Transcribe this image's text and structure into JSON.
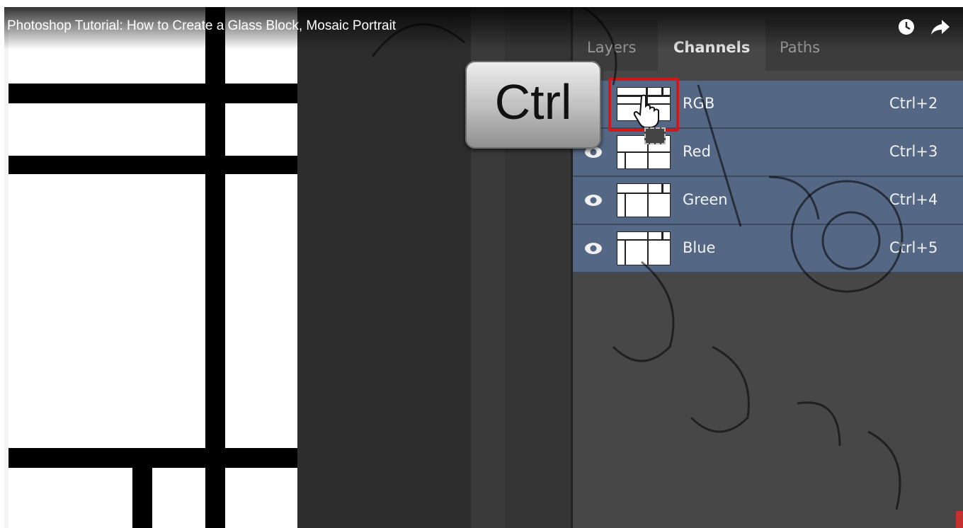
{
  "video": {
    "title": "Photoshop Tutorial: How to Create a Glass Block, Mosaic Portrait",
    "icons": [
      "clock-icon",
      "share-icon"
    ]
  },
  "overlay": {
    "key_label": "Ctrl"
  },
  "panel": {
    "tabs": [
      {
        "label": "Layers",
        "active": false
      },
      {
        "label": "Channels",
        "active": true
      },
      {
        "label": "Paths",
        "active": false
      }
    ],
    "channels": [
      {
        "name": "RGB",
        "shortcut": "Ctrl+2"
      },
      {
        "name": "Red",
        "shortcut": "Ctrl+3"
      },
      {
        "name": "Green",
        "shortcut": "Ctrl+4"
      },
      {
        "name": "Blue",
        "shortcut": "Ctrl+5"
      }
    ],
    "row_color": "#546784",
    "highlight_color": "#d01818"
  }
}
